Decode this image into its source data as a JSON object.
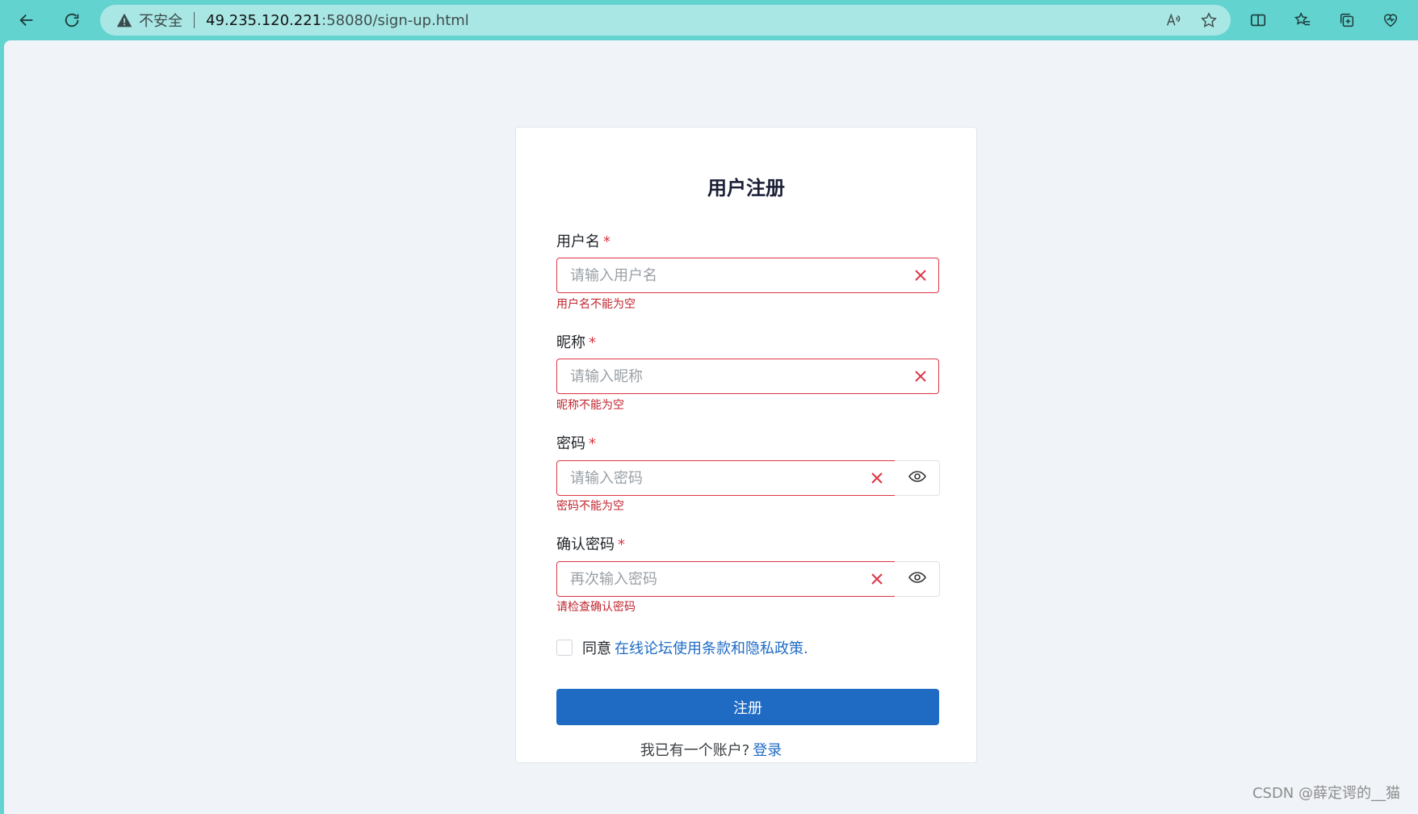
{
  "browser": {
    "security_label": "不安全",
    "url_host": "49.235.120.221",
    "url_path": ":58080/sign-up.html"
  },
  "form": {
    "title": "用户注册",
    "required_mark": "*",
    "fields": [
      {
        "label": "用户名",
        "placeholder": "请输入用户名",
        "error": "用户名不能为空"
      },
      {
        "label": "昵称",
        "placeholder": "请输入昵称",
        "error": "昵称不能为空"
      },
      {
        "label": "密码",
        "placeholder": "请输入密码",
        "error": "密码不能为空"
      },
      {
        "label": "确认密码",
        "placeholder": "再次输入密码",
        "error": "请检查确认密码"
      }
    ],
    "agree_prefix": "同意",
    "agree_link": "在线论坛使用条款和隐私政策.",
    "submit_label": "注册"
  },
  "footer": {
    "have_account_text": "我已有一个账户?",
    "login_link": "登录"
  },
  "watermark": "CSDN @薛定谔的__猫",
  "colors": {
    "browser_chrome": "#63d3cf",
    "error": "#dc3545",
    "primary": "#1f6bc4"
  }
}
